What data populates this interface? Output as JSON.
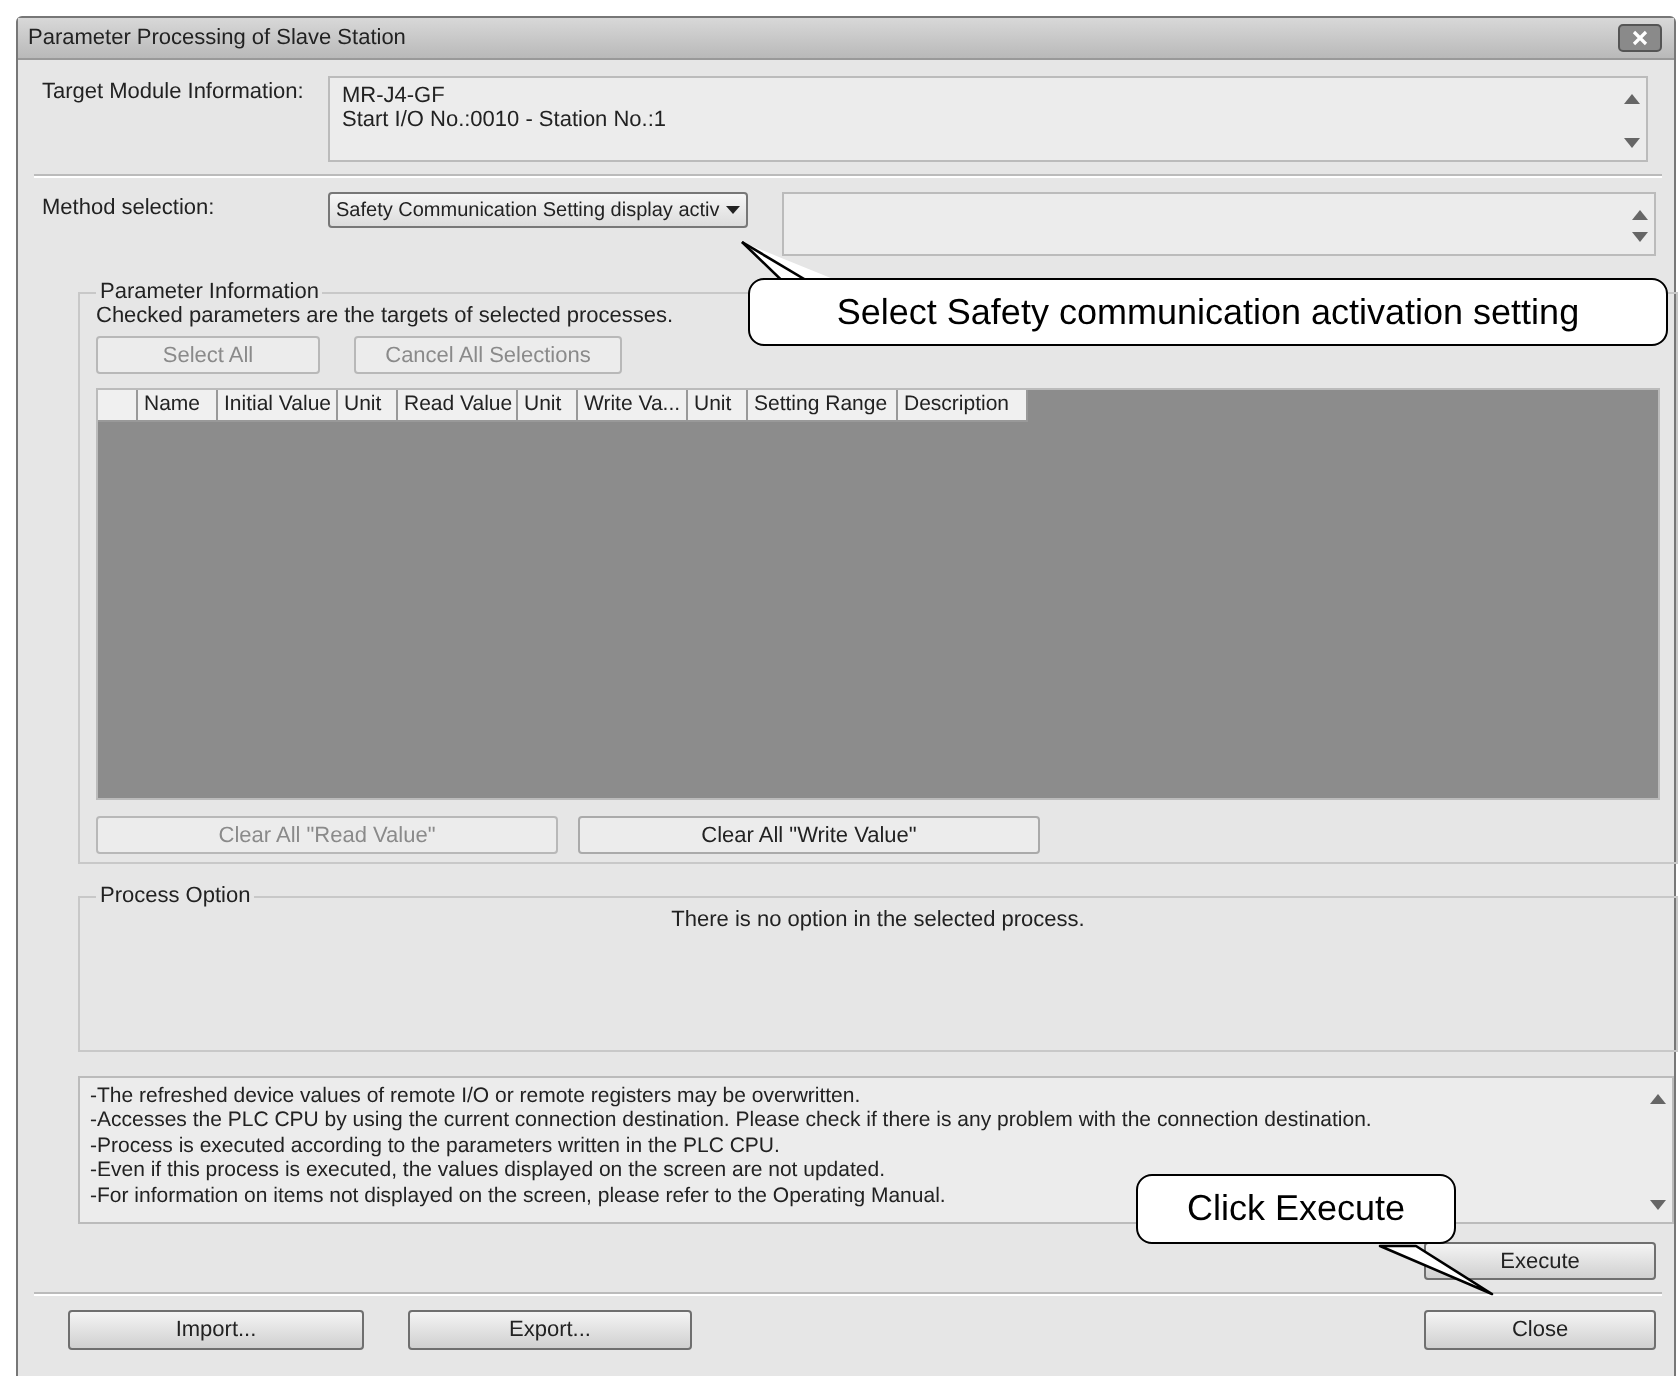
{
  "window": {
    "title": "Parameter Processing of Slave Station"
  },
  "target_module": {
    "label": "Target Module Information:",
    "lines": [
      "MR-J4-GF",
      "Start I/O No.:0010 - Station No.:1"
    ]
  },
  "method_selection": {
    "label": "Method selection:",
    "value": "Safety Communication Setting display activ"
  },
  "parameter_information": {
    "title": "Parameter Information",
    "note": "Checked parameters are the targets of selected processes.",
    "buttons": [
      {
        "label": "Select All",
        "disabled": true
      },
      {
        "label": "Cancel All Selections",
        "disabled": true
      }
    ],
    "table": {
      "columns": [
        "Name",
        "Initial Value",
        "Unit",
        "Read Value",
        "Unit",
        "Write Va...",
        "Unit",
        "Setting Range",
        "Description"
      ]
    },
    "clear_buttons": [
      {
        "label": "Clear All \"Read Value\"",
        "disabled": true
      },
      {
        "label": "Clear All \"Write Value\"",
        "disabled": false
      }
    ]
  },
  "process_option": {
    "title": "Process Option",
    "message": "There is no option in the selected process."
  },
  "notes": [
    "-The refreshed device values of remote I/O or remote registers may be overwritten.",
    "-Accesses the PLC CPU by using the current connection destination. Please check if there is any problem with the connection destination.",
    "-Process is executed according to the parameters written in the PLC CPU.",
    "-Even if this process is executed, the values displayed on the screen are not updated.",
    "-For information on items not displayed on the screen, please refer to the Operating Manual."
  ],
  "execute_button": "Execute",
  "bottom_buttons": [
    "Import...",
    "Export...",
    "Close"
  ],
  "callouts": [
    "Select Safety communication activation setting",
    "Click Execute"
  ]
}
